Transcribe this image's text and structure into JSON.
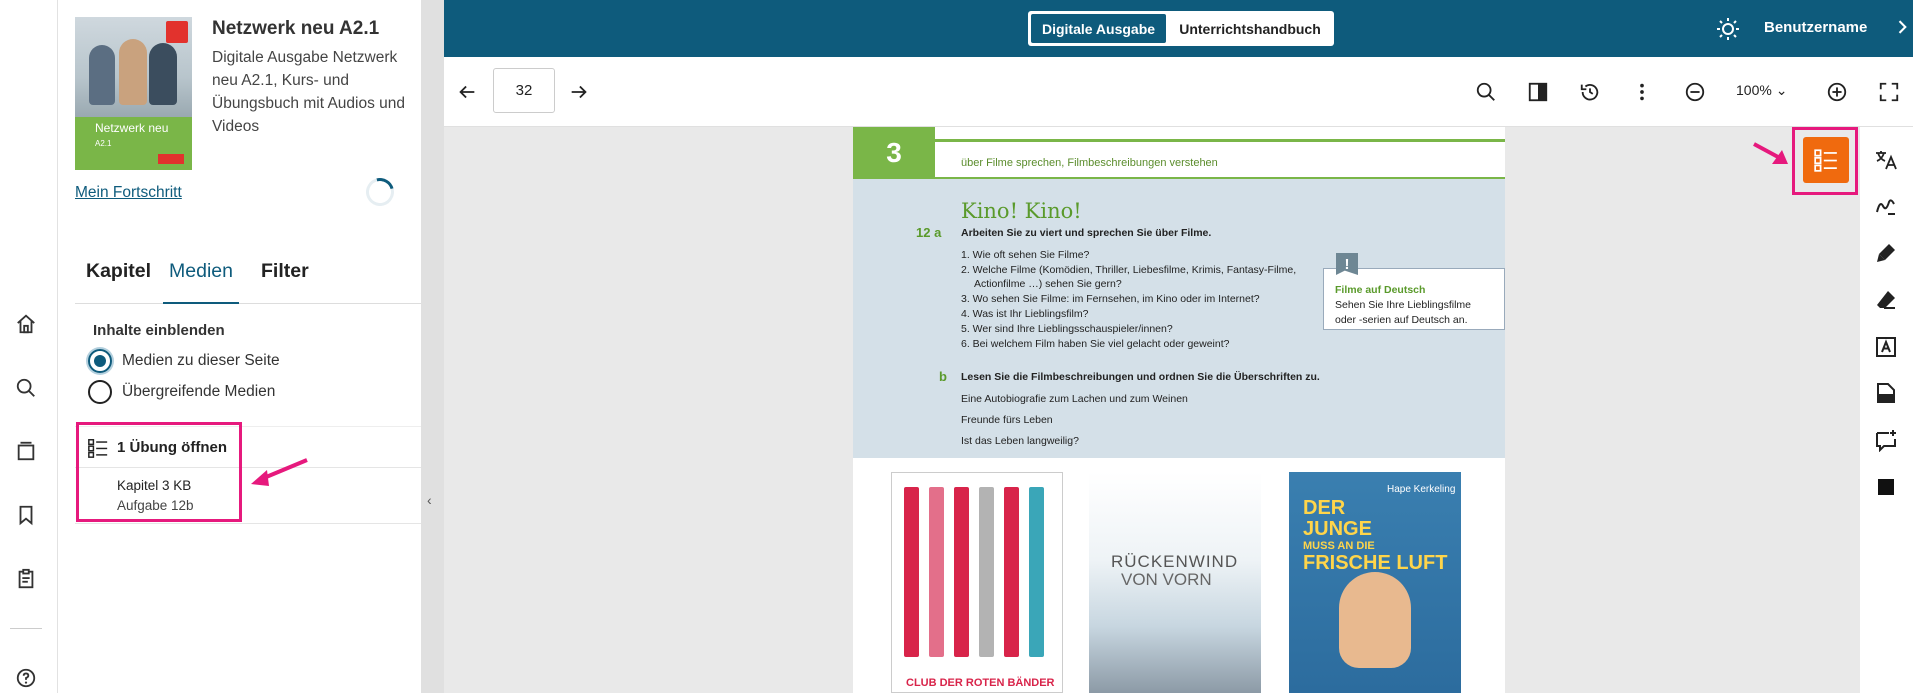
{
  "topbar": {
    "seg_active": "Digitale Ausgabe",
    "seg_inactive": "Unterrichtshandbuch",
    "username": "Benutzername",
    "bg_color": "#0e5b7c"
  },
  "rail": {
    "icons": [
      "home-icon",
      "search-icon",
      "library-icon",
      "bookmark-icon",
      "clipboard-icon",
      "help-icon"
    ]
  },
  "sidebar": {
    "book_title": "Netzwerk neu A2.1",
    "book_description": "Digitale Ausgabe Netzwerk neu A2.1, Kurs- und Übungsbuch mit Audios und Videos",
    "cover_title": "Netzwerk neu",
    "cover_subtitle": "A2.1",
    "progress_link": "Mein Fortschritt",
    "tabs": [
      "Kapitel",
      "Medien",
      "Filter"
    ],
    "active_tab": "Medien",
    "show_content_label": "Inhalte einblenden",
    "radio_options": [
      {
        "label": "Medien zu dieser Seite",
        "checked": true
      },
      {
        "label": "Übergreifende Medien",
        "checked": false
      }
    ],
    "exercise": {
      "header": "1 Übung öffnen",
      "line1": "Kapitel 3 KB",
      "line2": "Aufgabe 12b"
    }
  },
  "toolbar": {
    "page_number": "32",
    "zoom": "100%"
  },
  "page": {
    "chapter": "3",
    "header_text": "über Filme sprechen, Filmbeschreibungen verstehen",
    "title": "Kino! Kino!",
    "task_a_num": "12 a",
    "task_a": "Arbeiten Sie zu viert und sprechen Sie über Filme.",
    "questions": [
      "1. Wie oft sehen Sie Filme?",
      "2. Welche Filme (Komödien, Thriller, Liebesfilme, Krimis, Fantasy-Filme,",
      "Actionfilme …) sehen Sie gern?",
      "3. Wo sehen Sie Filme: im Fernsehen, im Kino oder im Internet?",
      "4. Was ist Ihr Lieblingsfilm?",
      "5. Wer sind Ihre Lieblingsschauspieler/innen?",
      "6. Bei welchem Film haben Sie viel gelacht oder geweint?"
    ],
    "info_title": "Filme auf Deutsch",
    "info_line1": "Sehen Sie Ihre Lieblingsfilme",
    "info_line2": "oder -serien auf Deutsch an.",
    "task_b_num": "b",
    "task_b": "Lesen Sie die Filmbeschreibungen und ordnen Sie die Überschriften zu.",
    "headings": [
      "Eine Autobiografie zum Lachen und zum Weinen",
      "Freunde fürs Leben",
      "Ist das Leben langweilig?"
    ],
    "poster1_title": "CLUB DER ROTEN BÄNDER",
    "poster2_title_a": "RÜCKENWIND",
    "poster2_title_b": "VON VORN",
    "poster3_title_a": "DER",
    "poster3_title_b": "JUNGE",
    "poster3_title_c": "MUSS AN DIE",
    "poster3_title_d": "FRISCHE LUFT",
    "poster3_name": "Hape Kerkeling"
  },
  "tools": {
    "icons": [
      "translate-icon",
      "pen-icon",
      "highlighter-icon",
      "eraser-icon",
      "text-box-icon",
      "note-icon",
      "add-comment-icon",
      "square-icon"
    ],
    "accent": "#f06a0e",
    "highlight": "#e6197d"
  }
}
